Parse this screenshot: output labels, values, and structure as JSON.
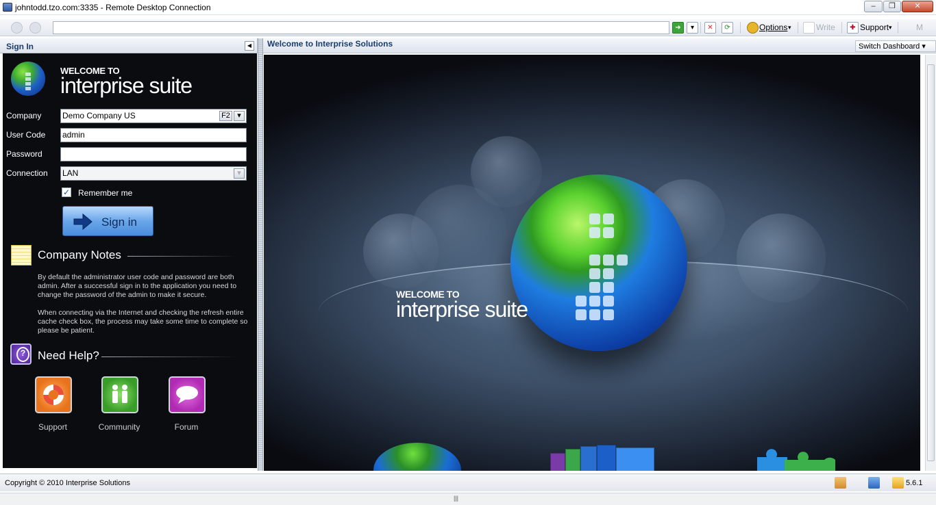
{
  "window": {
    "title": "johntodd.tzo.com:3335 - Remote Desktop Connection",
    "minimize": "–",
    "maximize": "❐",
    "close": "✕"
  },
  "toolbar": {
    "options_label": "Options",
    "write_label": "Write",
    "support_label": "Support",
    "more_label": "M"
  },
  "left_panel": {
    "header": "Sign In",
    "brand_welcome": "WELCOME TO",
    "brand_suite": "interprise suite",
    "form": {
      "company_label": "Company",
      "company_value": "Demo Company US",
      "company_key": "F2",
      "user_code_label": "User Code",
      "user_code_value": "admin",
      "password_label": "Password",
      "password_value": "",
      "connection_label": "Connection",
      "connection_value": "LAN",
      "remember_label": "Remember me",
      "remember_checked": true
    },
    "signin_label": "Sign in",
    "company_notes": {
      "title": "Company Notes",
      "paragraph1": "By default the administrator user code and password are both admin.  After a successful sign in to the application you need to change the password of the admin to make it secure.",
      "paragraph2": "When connecting via the Internet and checking the refresh entire cache check box, the process may take some time to complete so please be patient."
    },
    "help": {
      "title": "Need Help?",
      "links": [
        {
          "label": "Support",
          "icon": "lifebuoy-icon",
          "color": "#e8731c"
        },
        {
          "label": "Community",
          "icon": "people-icon",
          "color": "#3a9d2a"
        },
        {
          "label": "Forum",
          "icon": "speech-bubble-icon",
          "color": "#b12ab3"
        }
      ]
    }
  },
  "right_panel": {
    "header": "Welcome to Interprise Solutions",
    "switch_dashboard": "Switch Dashboard",
    "hero_welcome": "WELCOME TO",
    "hero_suite": "interprise suite"
  },
  "statusbar": {
    "copyright": "Copyright © 2010 Interprise Solutions",
    "version": "5.6.1"
  },
  "colors": {
    "panel_bg": "#0a0c10",
    "header_text": "#1b3d6e",
    "signin_button": "#6aa7ea"
  }
}
